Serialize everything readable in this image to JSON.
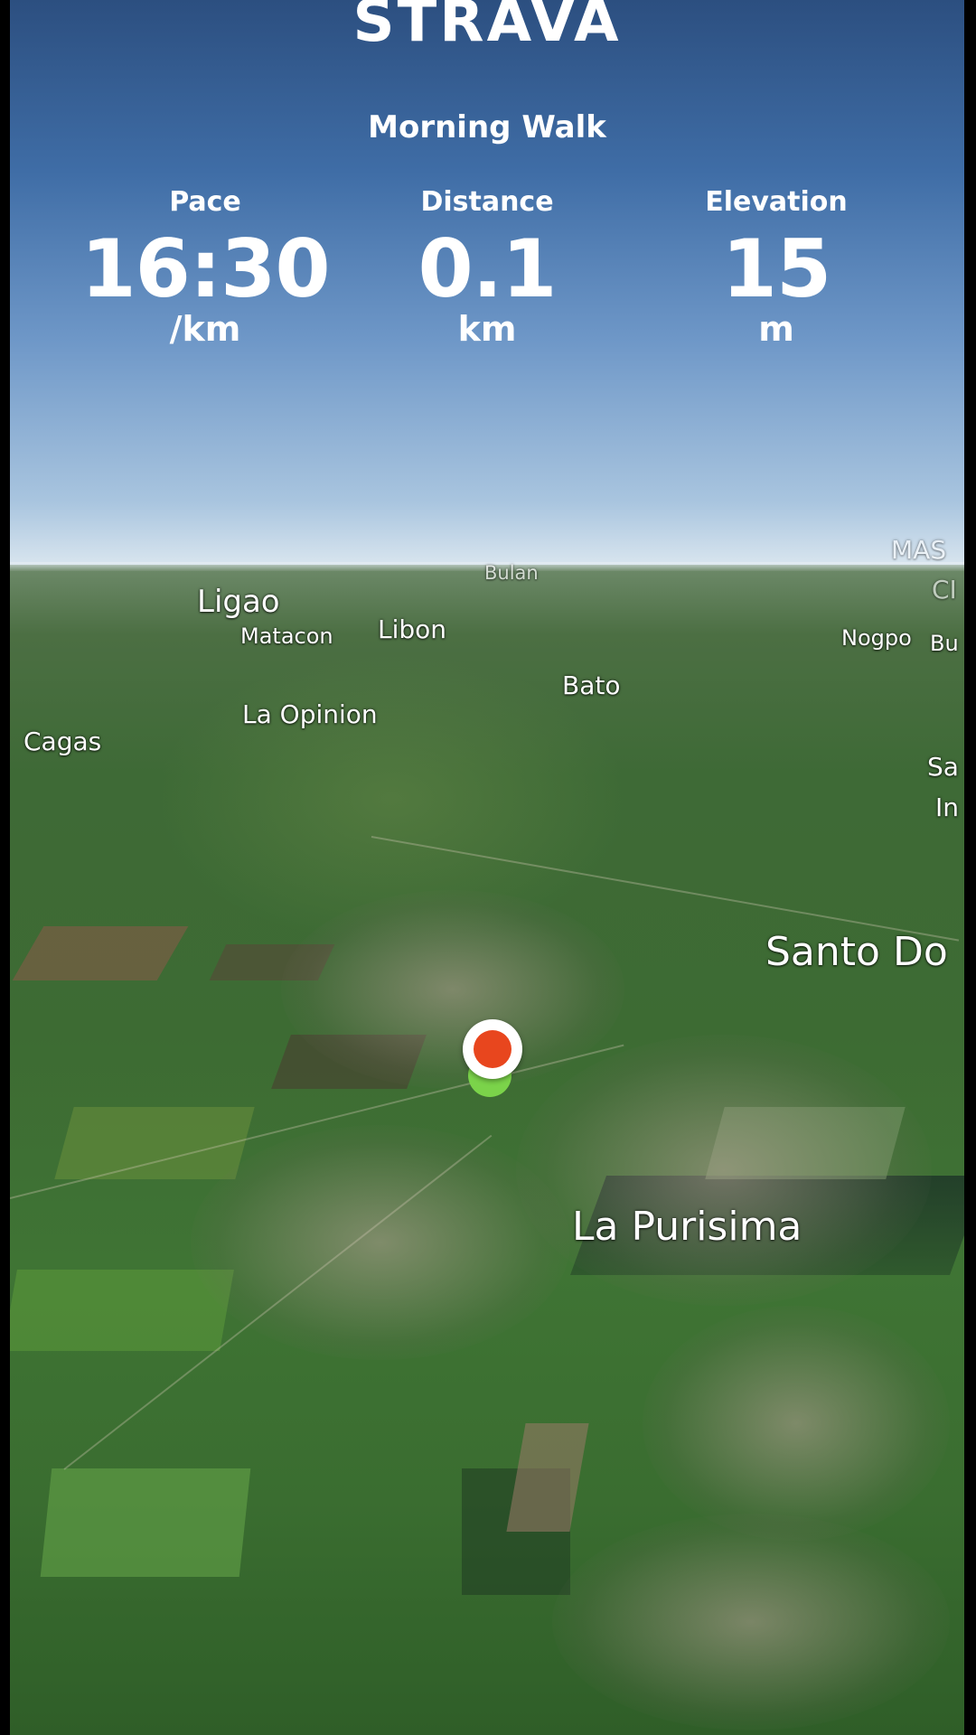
{
  "app": {
    "brand": "STRAVA"
  },
  "activity": {
    "title": "Morning Walk"
  },
  "stats": [
    {
      "label": "Pace",
      "value": "16:30",
      "unit": "/km"
    },
    {
      "label": "Distance",
      "value": "0.1",
      "unit": "km"
    },
    {
      "label": "Elevation",
      "value": "15",
      "unit": "m"
    }
  ],
  "map": {
    "places": [
      "Bulan",
      "Ligao",
      "Matacon",
      "Libon",
      "Nogpo",
      "Bu",
      "Bato",
      "La Opinion",
      "Cagas",
      "Sa",
      "In",
      "Santo Do",
      "La Purisima",
      "MAS",
      "CI"
    ]
  },
  "colors": {
    "marker_start": "#7bd34a",
    "marker_current": "#e8461e",
    "brand": "#ffffff"
  }
}
